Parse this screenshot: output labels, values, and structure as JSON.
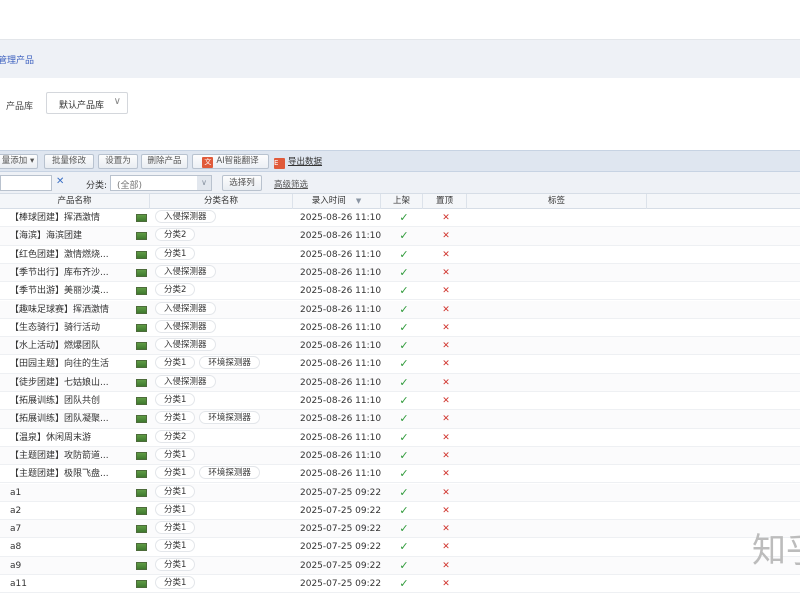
{
  "breadcrumb": "管理产品",
  "library": {
    "label": "产品库",
    "selected": "默认产品库"
  },
  "toolbar": {
    "batch_add": "量添加",
    "batch_edit": "批量修改",
    "set_as": "设置为",
    "delete": "删除产品",
    "ai_translate": "AI智能翻译",
    "export": "导出数据"
  },
  "filter": {
    "search_value": "",
    "category_label": "分类:",
    "category_selected": "(全部)",
    "select_columns": "选择列",
    "advanced_filter": "高级筛选"
  },
  "columns": {
    "name": "产品名称",
    "category": "分类名称",
    "time": "录入时间",
    "on_shelf": "上架",
    "pinned": "置顶",
    "tags": "标签"
  },
  "icons": {
    "on_shelf": "✓",
    "pinned": "✕",
    "clear": "✕",
    "dropdown": "∨",
    "sort": "▼"
  },
  "colors": {
    "check": "#2f9a3a",
    "cross": "#d0322b",
    "link": "#3b5fbf"
  },
  "rows": [
    {
      "name": "【棒球团建】挥洒激情",
      "cats": [
        "入侵探测器"
      ],
      "time": "2025-08-26 11:10"
    },
    {
      "name": "【海滨】海滨团建",
      "cats": [
        "分类2"
      ],
      "time": "2025-08-26 11:10"
    },
    {
      "name": "【红色团建】激情燃烧...",
      "cats": [
        "分类1"
      ],
      "time": "2025-08-26 11:10"
    },
    {
      "name": "【季节出行】库布齐沙...",
      "cats": [
        "入侵探测器"
      ],
      "time": "2025-08-26 11:10"
    },
    {
      "name": "【季节出游】美丽沙漠...",
      "cats": [
        "分类2"
      ],
      "time": "2025-08-26 11:10"
    },
    {
      "name": "【趣味足球赛】挥洒激情",
      "cats": [
        "入侵探测器"
      ],
      "time": "2025-08-26 11:10"
    },
    {
      "name": "【生态骑行】骑行活动",
      "cats": [
        "入侵探测器"
      ],
      "time": "2025-08-26 11:10"
    },
    {
      "name": "【水上活动】燃爆团队",
      "cats": [
        "入侵探测器"
      ],
      "time": "2025-08-26 11:10"
    },
    {
      "name": "【田园主题】向往的生活",
      "cats": [
        "分类1",
        "环境探测器"
      ],
      "time": "2025-08-26 11:10"
    },
    {
      "name": "【徒步团建】七姑娘山...",
      "cats": [
        "入侵探测器"
      ],
      "time": "2025-08-26 11:10"
    },
    {
      "name": "【拓展训练】团队共创",
      "cats": [
        "分类1"
      ],
      "time": "2025-08-26 11:10"
    },
    {
      "name": "【拓展训练】团队凝聚...",
      "cats": [
        "分类1",
        "环境探测器"
      ],
      "time": "2025-08-26 11:10"
    },
    {
      "name": "【温泉】休闲周末游",
      "cats": [
        "分类2"
      ],
      "time": "2025-08-26 11:10"
    },
    {
      "name": "【主题团建】攻防箭道...",
      "cats": [
        "分类1"
      ],
      "time": "2025-08-26 11:10"
    },
    {
      "name": "【主题团建】极限飞盘...",
      "cats": [
        "分类1",
        "环境探测器"
      ],
      "time": "2025-08-26 11:10"
    },
    {
      "name": "a1",
      "cats": [
        "分类1"
      ],
      "time": "2025-07-25 09:22"
    },
    {
      "name": "a2",
      "cats": [
        "分类1"
      ],
      "time": "2025-07-25 09:22"
    },
    {
      "name": "a7",
      "cats": [
        "分类1"
      ],
      "time": "2025-07-25 09:22"
    },
    {
      "name": "a8",
      "cats": [
        "分类1"
      ],
      "time": "2025-07-25 09:22"
    },
    {
      "name": "a9",
      "cats": [
        "分类1"
      ],
      "time": "2025-07-25 09:22"
    },
    {
      "name": "a11",
      "cats": [
        "分类1"
      ],
      "time": "2025-07-25 09:22"
    }
  ],
  "watermark": "知乎"
}
